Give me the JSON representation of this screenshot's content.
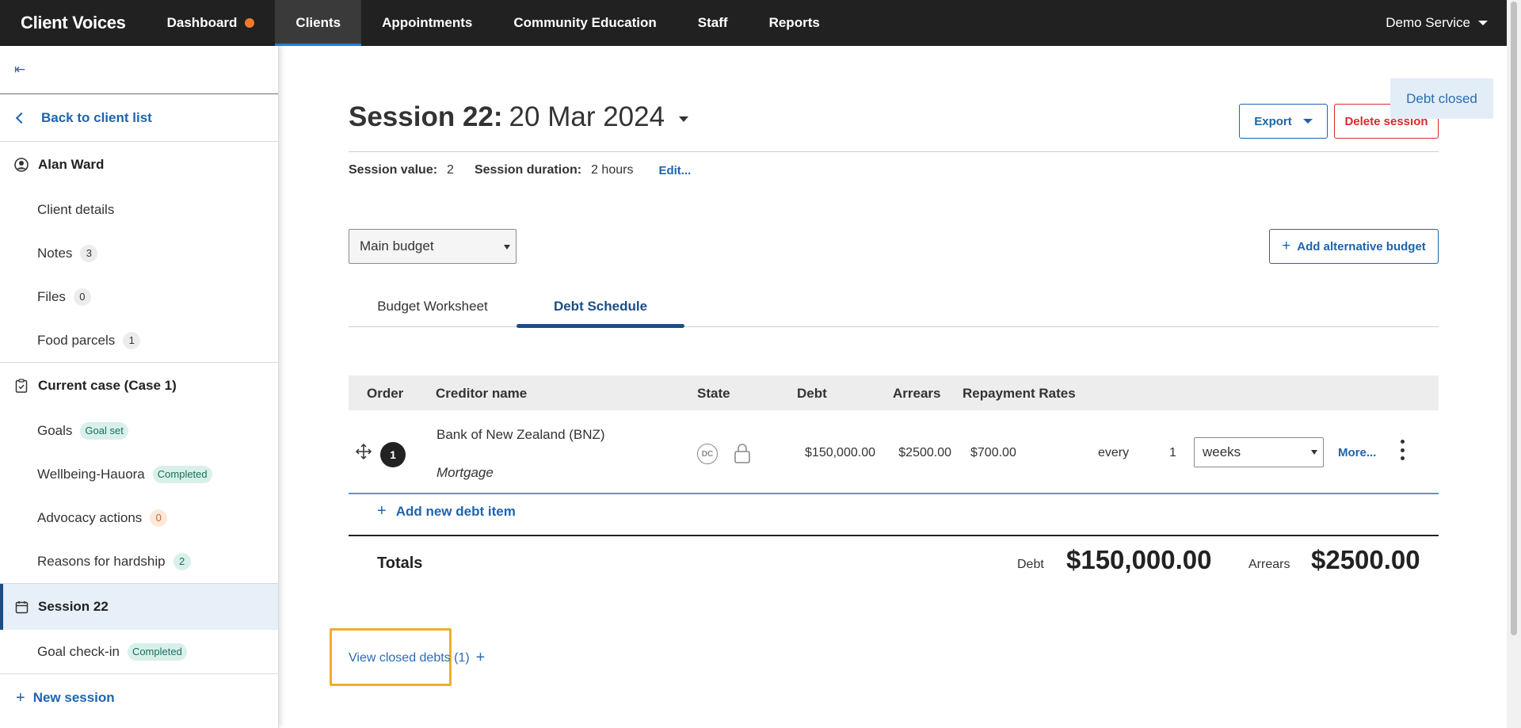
{
  "nav": {
    "brand": "Client Voices",
    "items": [
      {
        "label": "Dashboard",
        "dot": true
      },
      {
        "label": "Clients",
        "active": true
      },
      {
        "label": "Appointments"
      },
      {
        "label": "Community Education"
      },
      {
        "label": "Staff"
      },
      {
        "label": "Reports"
      }
    ],
    "service": "Demo Service"
  },
  "sidebar": {
    "collapse_icon": "⇤",
    "back": "Back to client list",
    "client_name": "Alan Ward",
    "client_items": [
      {
        "label": "Client details",
        "badge": null
      },
      {
        "label": "Notes",
        "badge": "3"
      },
      {
        "label": "Files",
        "badge": "0"
      },
      {
        "label": "Food parcels",
        "badge": "1"
      }
    ],
    "case_title": "Current case (Case 1)",
    "case_items": [
      {
        "label": "Goals",
        "badge": "Goal set",
        "badge_style": "green"
      },
      {
        "label": "Wellbeing-Hauora",
        "badge": "Completed",
        "badge_style": "green"
      },
      {
        "label": "Advocacy actions",
        "badge": "0",
        "badge_style": "orange"
      },
      {
        "label": "Reasons for hardship",
        "badge": "2",
        "badge_style": "green"
      }
    ],
    "session_title": "Session 22",
    "session_items": [
      {
        "label": "Goal check-in",
        "badge": "Completed",
        "badge_style": "green"
      }
    ],
    "new_session": "New session"
  },
  "session": {
    "title_bold": "Session 22:",
    "title_date": "20 Mar 2024",
    "export_label": "Export",
    "delete_label": "Delete session",
    "toast": "Debt closed",
    "value_label": "Session value:",
    "value": "2",
    "duration_label": "Session duration:",
    "duration": "2 hours",
    "edit_label": "Edit..."
  },
  "budget": {
    "selected": "Main budget",
    "add_alt_label": "Add alternative budget"
  },
  "tabs": [
    {
      "label": "Budget Worksheet",
      "active": false
    },
    {
      "label": "Debt Schedule",
      "active": true
    }
  ],
  "debt_table": {
    "headers": {
      "order": "Order",
      "creditor": "Creditor name",
      "state": "State",
      "debt": "Debt",
      "arrears": "Arrears",
      "rates": "Repayment Rates"
    },
    "rows": [
      {
        "order": "1",
        "creditor": "Bank of New Zealand (BNZ)",
        "type": "Mortgage",
        "state_badge": "DC",
        "debt": "$150,000.00",
        "arrears": "$2500.00",
        "repayment": "$700.00",
        "every": "every",
        "frequency": "1",
        "period": "weeks",
        "more": "More..."
      }
    ],
    "add_label": "Add new debt item"
  },
  "totals": {
    "label": "Totals",
    "debt_label": "Debt",
    "debt_value": "$150,000.00",
    "arrears_label": "Arrears",
    "arrears_value": "$2500.00"
  },
  "closed_debts_label": "View closed debts (1)",
  "colors": {
    "nav_bg": "#212121",
    "accent_blue": "#1f64ad",
    "active_dark": "#1b4e86",
    "danger": "#d62c2c",
    "highlight": "#f0ad2e",
    "dot": "#f07a2a"
  }
}
